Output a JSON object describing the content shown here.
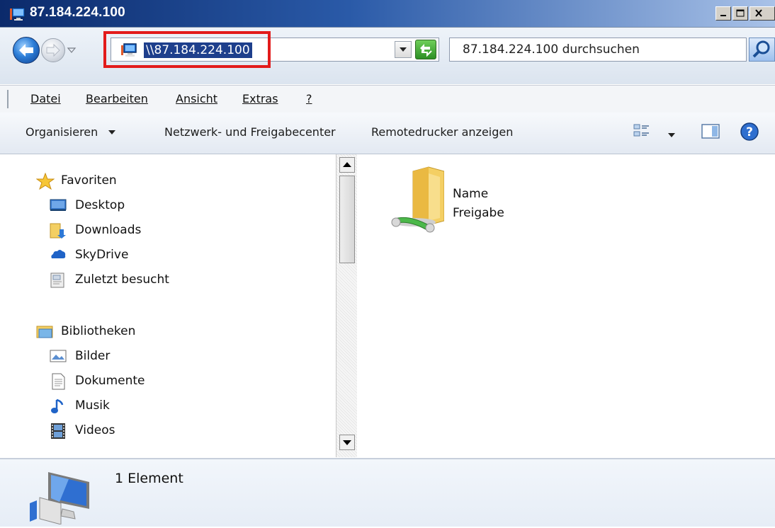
{
  "window": {
    "title": "87.184.224.100"
  },
  "address": {
    "path": "\\\\87.184.224.100",
    "search_placeholder": "87.184.224.100 durchsuchen"
  },
  "menubar": {
    "items": [
      {
        "label": "Datei",
        "accel": "D"
      },
      {
        "label": "Bearbeiten",
        "accel": "B"
      },
      {
        "label": "Ansicht",
        "accel": "A"
      },
      {
        "label": "Extras",
        "accel": "x"
      },
      {
        "label": "?",
        "accel": "?"
      }
    ]
  },
  "commandbar": {
    "organize": "Organisieren",
    "network_center": "Netzwerk- und Freigabecenter",
    "remote_printers": "Remotedrucker anzeigen"
  },
  "navigation": {
    "favorites": {
      "label": "Favoriten",
      "items": [
        "Desktop",
        "Downloads",
        "SkyDrive",
        "Zuletzt besucht"
      ]
    },
    "libraries": {
      "label": "Bibliotheken",
      "items": [
        "Bilder",
        "Dokumente",
        "Musik",
        "Videos"
      ]
    }
  },
  "content": {
    "items": [
      {
        "name": "Name",
        "subtitle": "Freigabe"
      }
    ]
  },
  "details": {
    "count_text": "1 Element"
  },
  "colors": {
    "address_highlight": "#e21b1b",
    "selection": "#1e3f8c"
  },
  "icons": {
    "title": "network-computer-icon",
    "back": "back-arrow-icon",
    "forward": "forward-arrow-icon",
    "search": "magnifier-icon",
    "refresh": "refresh-icon",
    "help": "help-icon",
    "views": "view-options-icon",
    "preview": "preview-pane-icon"
  }
}
